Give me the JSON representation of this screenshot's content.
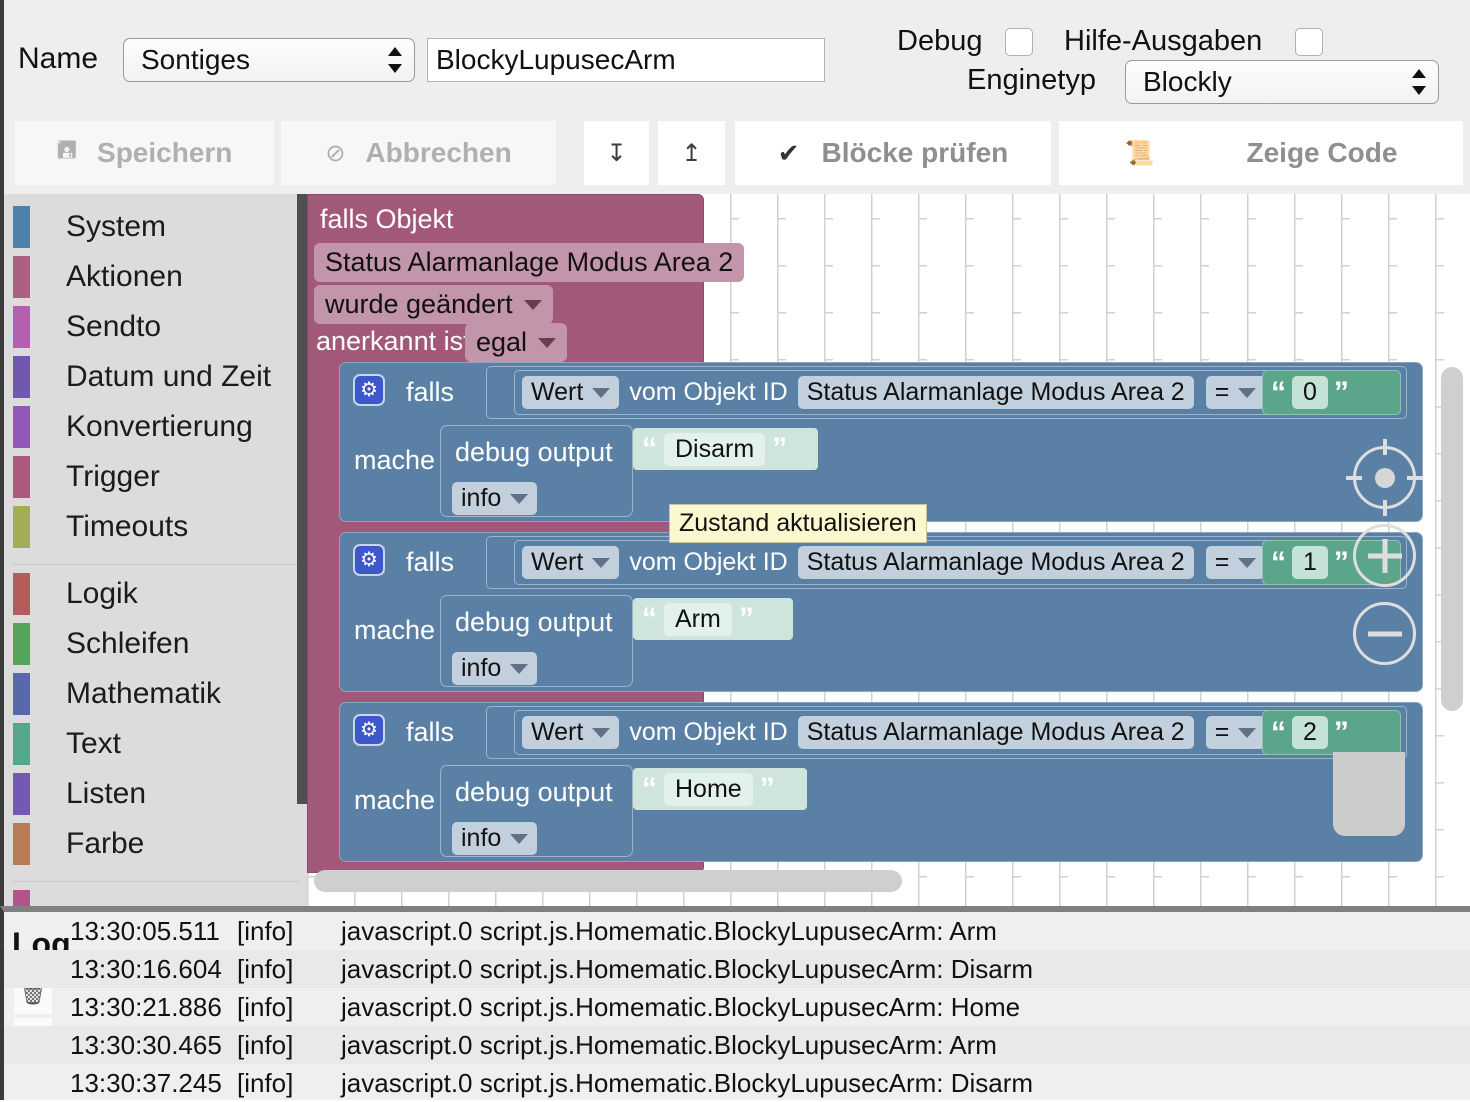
{
  "header": {
    "name_label": "Name",
    "category_value": "Sontiges",
    "script_name": "BlockyLupusecArm",
    "debug_label": "Debug",
    "help_output_label": "Hilfe-Ausgaben",
    "enginetype_label": "Enginetyp",
    "enginetype_value": "Blockly"
  },
  "toolbar": {
    "save_label": "Speichern",
    "save_icon": "save-icon",
    "cancel_label": "Abbrechen",
    "cancel_icon": "cancel-icon",
    "import_icon": "download-icon",
    "export_icon": "upload-icon",
    "check_blocks_label": "Blöcke prüfen",
    "check_icon": "checkmark-icon",
    "show_code_label": "Zeige Code",
    "code_icon": "scroll-icon"
  },
  "toolbox": {
    "groups": [
      {
        "items": [
          {
            "label": "System",
            "color": "#4f81a8"
          },
          {
            "label": "Aktionen",
            "color": "#ad5f84"
          },
          {
            "label": "Sendto",
            "color": "#b45fb0"
          },
          {
            "label": "Datum und Zeit",
            "color": "#7158ad"
          },
          {
            "label": "Konvertierung",
            "color": "#9158b5"
          },
          {
            "label": "Trigger",
            "color": "#ab5b80"
          },
          {
            "label": "Timeouts",
            "color": "#a3ad55"
          }
        ]
      },
      {
        "items": [
          {
            "label": "Logik",
            "color": "#b45b5b"
          },
          {
            "label": "Schleifen",
            "color": "#56a35c"
          },
          {
            "label": "Mathematik",
            "color": "#5868ab"
          },
          {
            "label": "Text",
            "color": "#54a68d"
          },
          {
            "label": "Listen",
            "color": "#7358b5"
          },
          {
            "label": "Farbe",
            "color": "#b87a58"
          }
        ]
      },
      {
        "items": [
          {
            "label": "",
            "color": "#b4538a"
          }
        ]
      }
    ]
  },
  "workspace": {
    "trigger_block": {
      "color": "#a25878",
      "line1": "falls Objekt",
      "object_id": "Status Alarmanlage Modus Area 2",
      "condition": "wurde geändert",
      "ack_label": "anerkannt ist",
      "ack_value": "egal"
    },
    "if_blocks": [
      {
        "gear_icon": "gear-icon",
        "if_label": "falls",
        "do_label": "mache",
        "getter_field": "Wert",
        "getter_text": "vom Objekt ID",
        "getter_object": "Status Alarmanlage Modus Area 2",
        "operator": "=",
        "compare_value": "0",
        "statement_label": "debug output",
        "statement_level": "info",
        "statement_text": "Disarm"
      },
      {
        "gear_icon": "gear-icon",
        "if_label": "falls",
        "do_label": "mache",
        "getter_field": "Wert",
        "getter_text": "vom Objekt ID",
        "getter_object": "Status Alarmanlage Modus Area 2",
        "operator": "=",
        "compare_value": "1",
        "statement_label": "debug output",
        "statement_level": "info",
        "statement_text": "Arm"
      },
      {
        "gear_icon": "gear-icon",
        "if_label": "falls",
        "do_label": "mache",
        "getter_field": "Wert",
        "getter_text": "vom Objekt ID",
        "getter_object": "Status Alarmanlage Modus Area 2",
        "operator": "=",
        "compare_value": "2",
        "statement_label": "debug output",
        "statement_level": "info",
        "statement_text": "Home"
      }
    ],
    "tooltip": "Zustand aktualisieren",
    "zoom_controls": {
      "center_icon": "zoom-reset-icon",
      "zoom_in_icon": "zoom-in-icon",
      "zoom_out_icon": "zoom-out-icon"
    },
    "trash_icon": "trash-dropzone"
  },
  "log": {
    "title": "Log",
    "clear_icon": "trash-icon",
    "download_icon": "download-icon",
    "rows": [
      {
        "time": "13:30:05.511",
        "level": "[info]",
        "message": "javascript.0 script.js.Homematic.BlockyLupusecArm: Arm"
      },
      {
        "time": "13:30:16.604",
        "level": "[info]",
        "message": "javascript.0 script.js.Homematic.BlockyLupusecArm: Disarm"
      },
      {
        "time": "13:30:21.886",
        "level": "[info]",
        "message": "javascript.0 script.js.Homematic.BlockyLupusecArm: Home"
      },
      {
        "time": "13:30:30.465",
        "level": "[info]",
        "message": "javascript.0 script.js.Homematic.BlockyLupusecArm: Arm"
      },
      {
        "time": "13:30:37.245",
        "level": "[info]",
        "message": "javascript.0 script.js.Homematic.BlockyLupusecArm: Disarm"
      }
    ]
  }
}
